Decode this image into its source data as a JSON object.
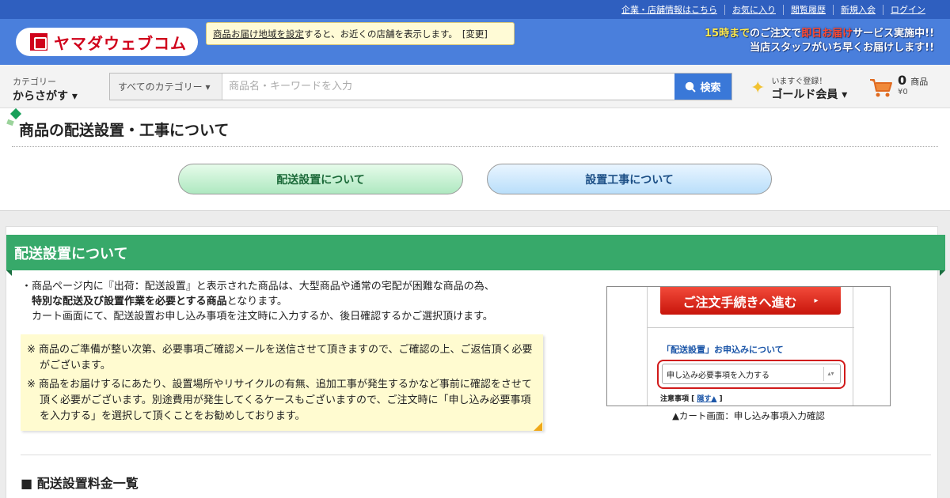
{
  "top_links": [
    "企業・店舗情報はこちら",
    "お気に入り",
    "閲覧履歴",
    "新規入会",
    "ログイン"
  ],
  "logo": {
    "text": "ヤマダウェブコム"
  },
  "delivery_area": {
    "link_text": "商品お届け地域を設定",
    "text": "すると、お近くの店舗を表示します。",
    "change_label": "[変更]"
  },
  "promo": {
    "line1_time": "15時まで",
    "line1_mid": "のご注文で",
    "line1_hl": "即日お届け",
    "line1_end": "サービス実施中!!",
    "line2": "当店スタッフがいち早くお届けします!!"
  },
  "category": {
    "small": "カテゴリー",
    "big": "からさがす ▾"
  },
  "search": {
    "category_select": "すべてのカテゴリー ▾",
    "placeholder": "商品名・キーワードを入力",
    "button_label": "検索"
  },
  "member": {
    "small": "いますぐ登録！",
    "big": "ゴールド会員 ▾"
  },
  "cart": {
    "count": "0",
    "unit": "商品",
    "amount": "¥0"
  },
  "page_title": "商品の配送設置・工事について",
  "tabs": {
    "delivery": "配送設置について",
    "construction": "設置工事について"
  },
  "section": {
    "title": "配送設置について",
    "bullet": "・",
    "line1": "商品ページ内に『出荷：配送設置』と表示された商品は、大型商品や通常の宅配が困難な商品の為、",
    "line2_bold": "特別な配送及び設置作業を必要とする商品",
    "line2_rest": "となります。",
    "line3": "カート画面にて、配送設置お申し込み事項を注文時に入力するか、後日確認するかご選択頂けます。",
    "notice1": "※ 商品のご準備が整い次第、必要事項ご確認メールを送信させて頂きますので、ご確認の上、ご返信頂く必要がございます。",
    "notice2": "※ 商品をお届けするにあたり、設置場所やリサイクルの有無、追加工事が発生するかなど事前に確認をさせて頂く必要がございます。別途費用が発生してくるケースもございますので、ご注文時に「申し込み必要事項を入力する」を選択して頂くことをお勧めしております。",
    "screenshot": {
      "button": "ご注文手続きへ進む",
      "button_arrow": "▸",
      "label": "「配送設置」お申込みについて",
      "select_value": "申し込み必要事項を入力する",
      "spinner": "▴▾",
      "note_prefix": "注意事項 [",
      "note_link": "隠す▲",
      "note_suffix": "]"
    },
    "caption": "▲カート画面：申し込み事項入力確認",
    "sub_heading": "■ 配送設置料金一覧"
  }
}
